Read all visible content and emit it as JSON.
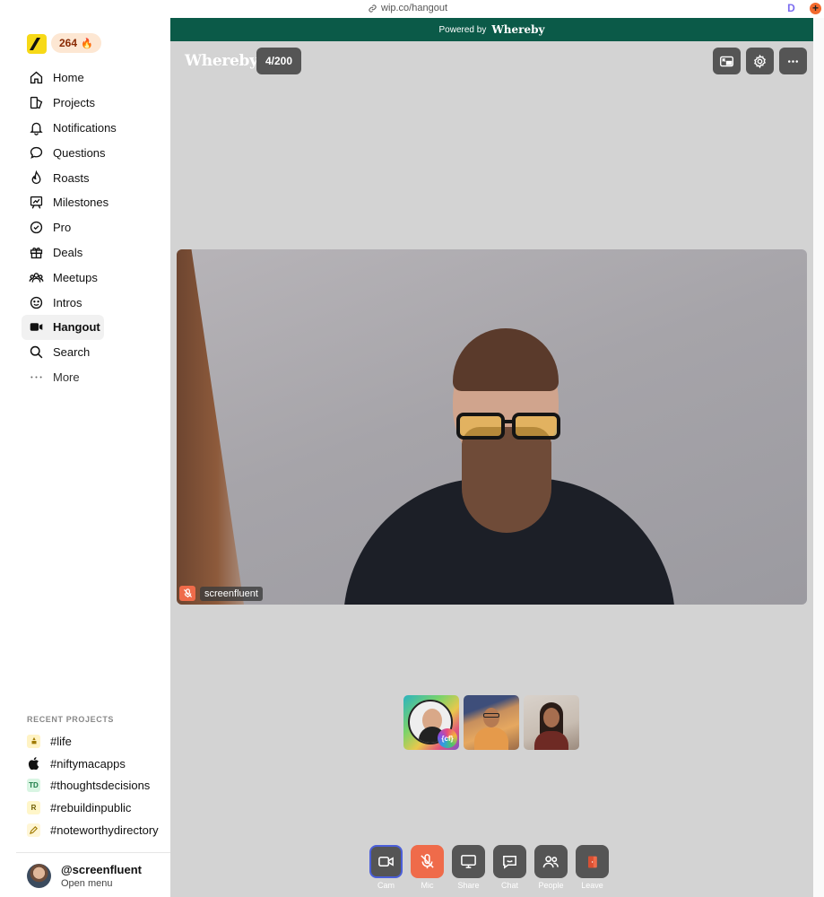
{
  "browser": {
    "url": "wip.co/hangout",
    "extension_d": "D",
    "extension_plus": "+"
  },
  "sidebar": {
    "streak": "264",
    "nav": [
      {
        "label": "Home",
        "icon": "home-icon"
      },
      {
        "label": "Projects",
        "icon": "projects-icon"
      },
      {
        "label": "Notifications",
        "icon": "bell-icon"
      },
      {
        "label": "Questions",
        "icon": "chat-bubble-icon"
      },
      {
        "label": "Roasts",
        "icon": "fire-icon"
      },
      {
        "label": "Milestones",
        "icon": "milestone-chart-icon"
      },
      {
        "label": "Pro",
        "icon": "check-badge-icon"
      },
      {
        "label": "Deals",
        "icon": "gift-icon"
      },
      {
        "label": "Meetups",
        "icon": "people-group-icon"
      },
      {
        "label": "Intros",
        "icon": "smiley-icon"
      },
      {
        "label": "Hangout",
        "icon": "video-camera-icon",
        "active": true
      },
      {
        "label": "Search",
        "icon": "search-icon"
      },
      {
        "label": "More",
        "icon": "ellipsis-icon"
      }
    ],
    "recent_title": "RECENT PROJECTS",
    "recent_projects": [
      {
        "label": "#life",
        "badge": "",
        "badge_bg": "#fff3c4",
        "badge_color": "#8a6d00"
      },
      {
        "label": "#niftymacapps",
        "badge": "",
        "badge_bg": "#ffffff",
        "badge_color": "#111111"
      },
      {
        "label": "#thoughtsdecisions",
        "badge": "TD",
        "badge_bg": "#d9f5e3",
        "badge_color": "#1a7a45"
      },
      {
        "label": "#rebuildinpublic",
        "badge": "R",
        "badge_bg": "#fff6c9",
        "badge_color": "#6b5a00"
      },
      {
        "label": "#noteworthydirectory",
        "badge": "",
        "badge_bg": "#fff6d6",
        "badge_color": "#7a5a00"
      }
    ],
    "user": {
      "handle": "@screenfluent",
      "sub": "Open menu"
    }
  },
  "whereby": {
    "powered_prefix": "Powered by",
    "powered_brand": "Whereby",
    "logo": "Whereby",
    "participant_count": "4/200",
    "main_video_name": "screenfluent",
    "thumb_badge": "{cf}",
    "controls": [
      {
        "label": "Cam",
        "name": "cam"
      },
      {
        "label": "Mic",
        "name": "mic"
      },
      {
        "label": "Share",
        "name": "share"
      },
      {
        "label": "Chat",
        "name": "chat"
      },
      {
        "label": "People",
        "name": "people"
      },
      {
        "label": "Leave",
        "name": "leave"
      }
    ],
    "colors": {
      "banner": "#0b5a48",
      "stage_bg": "#d3d3d3",
      "mic_muted": "#ef6b4a",
      "cam_outline": "#4b5fd9"
    }
  }
}
